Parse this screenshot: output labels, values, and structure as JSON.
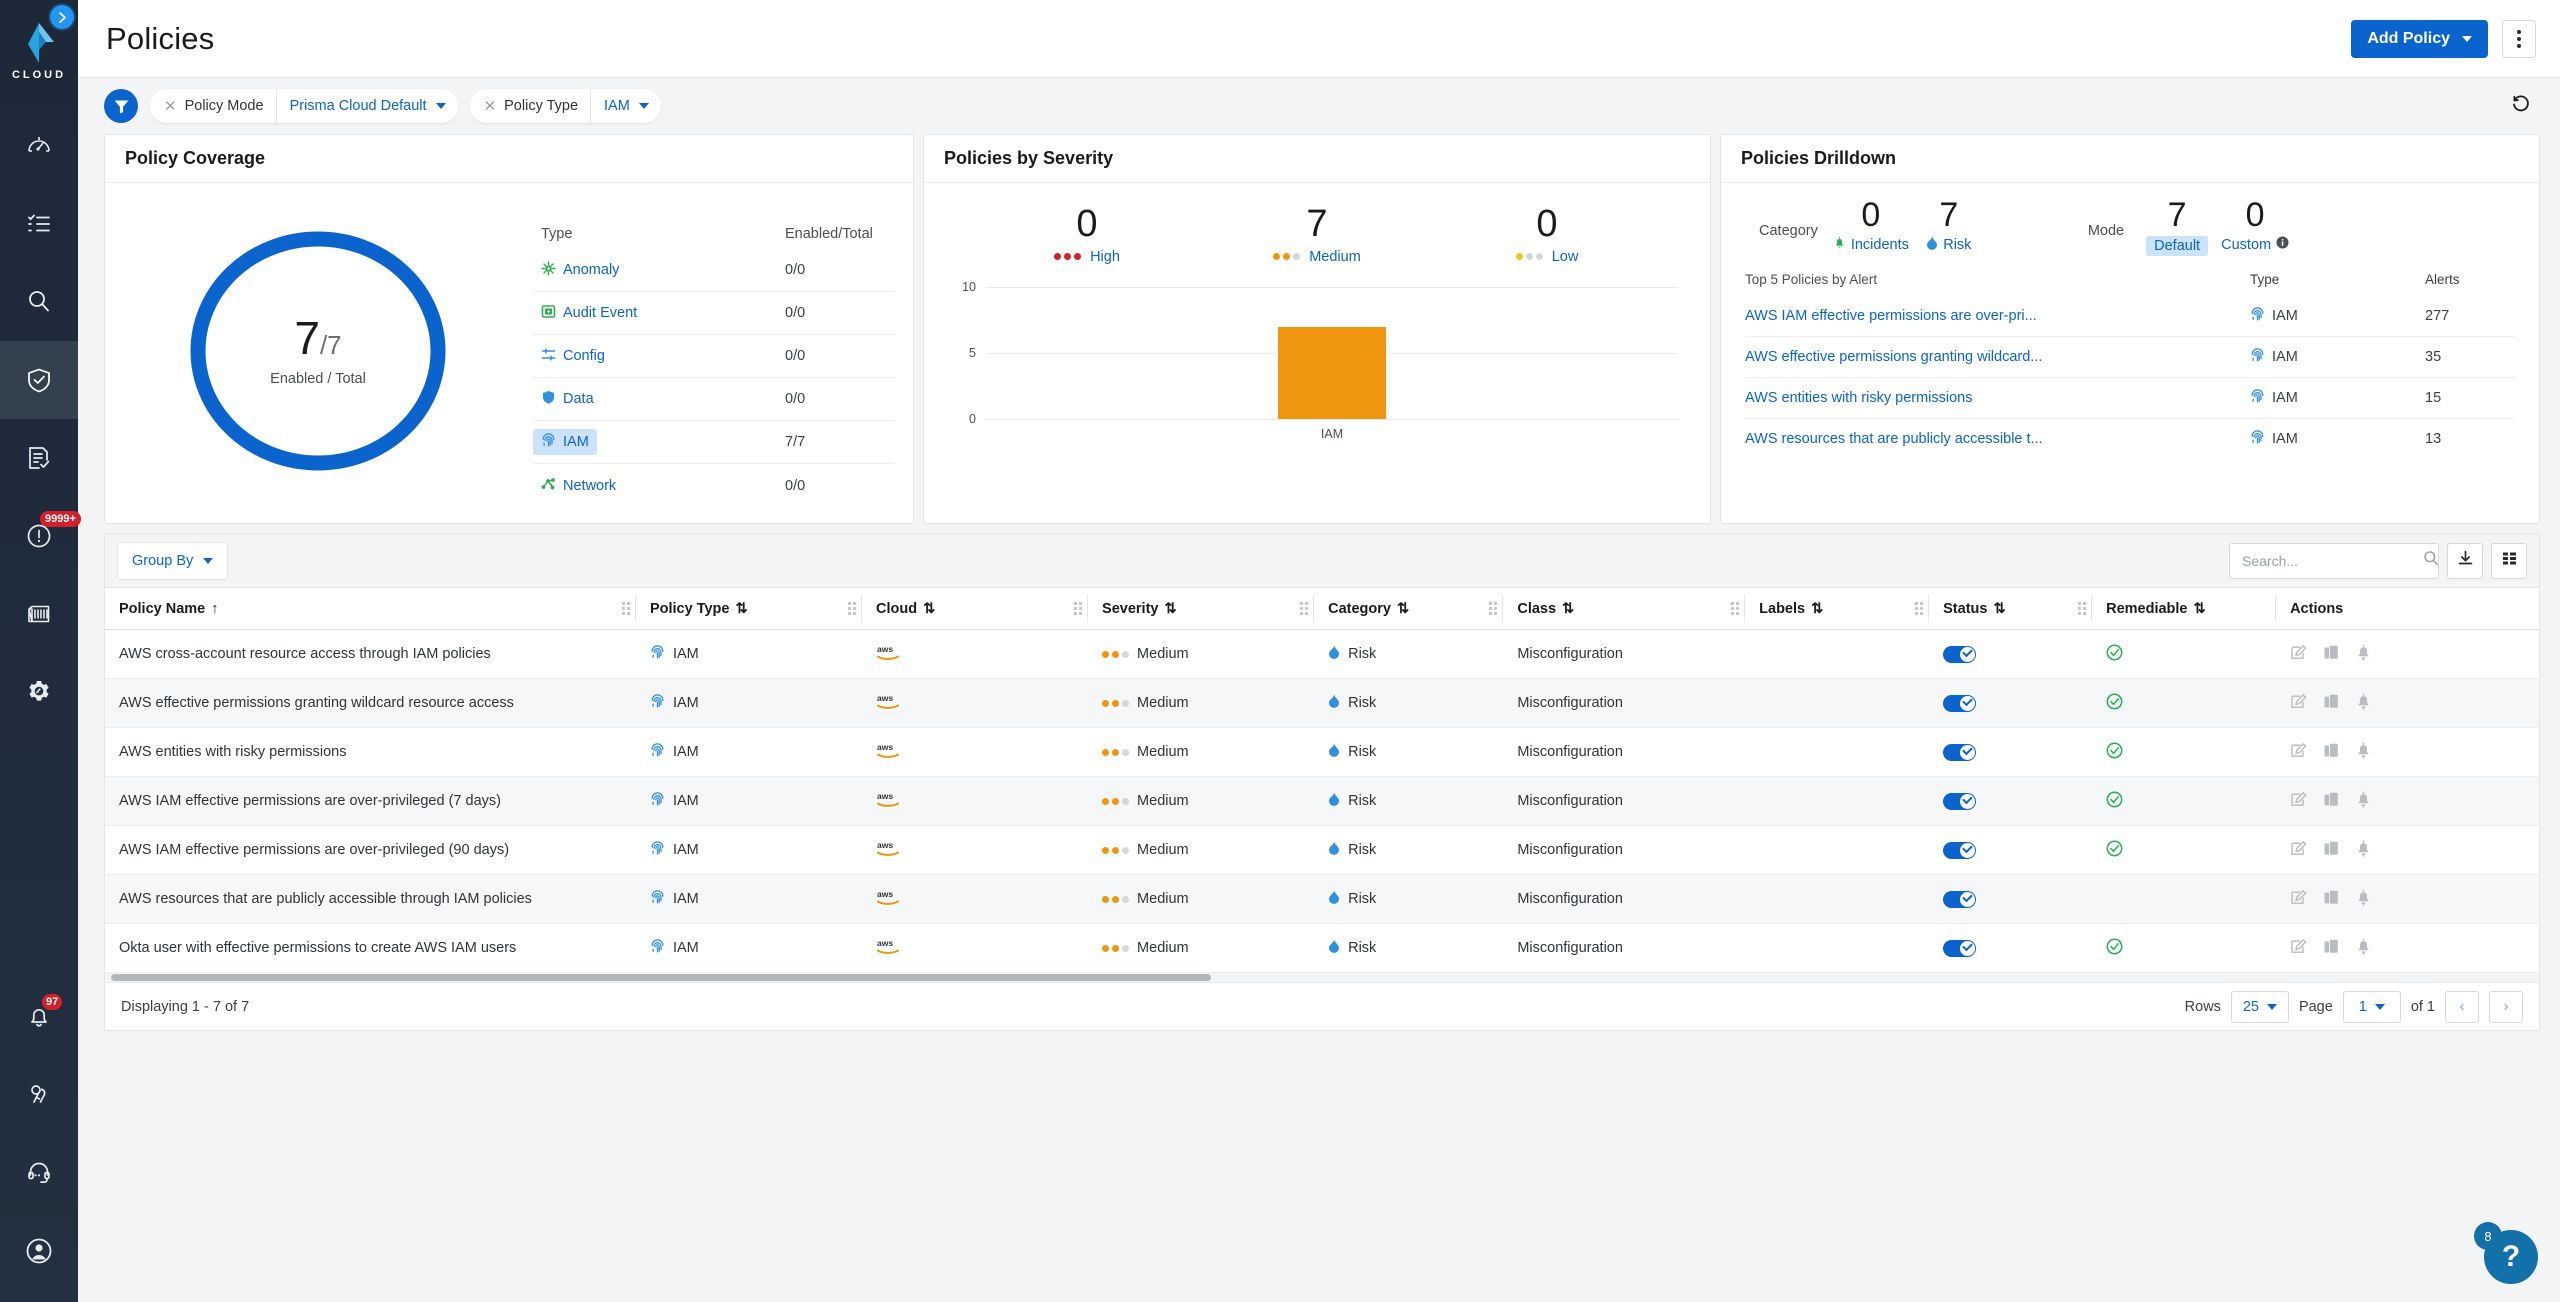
{
  "sidebar": {
    "logo_text": "CLOUD",
    "expand_icon": "chevron-right-icon",
    "items": [
      {
        "name": "dashboard",
        "icon": "speedometer-icon",
        "badge": null,
        "active": false
      },
      {
        "name": "inventory",
        "icon": "checklist-icon",
        "badge": null,
        "active": false
      },
      {
        "name": "investigate",
        "icon": "magnifier-icon",
        "badge": null,
        "active": false
      },
      {
        "name": "policies",
        "icon": "shield-check-icon",
        "badge": null,
        "active": true
      },
      {
        "name": "compliance",
        "icon": "document-check-icon",
        "badge": null,
        "active": false
      },
      {
        "name": "alerts",
        "icon": "alert-circle-icon",
        "badge": "9999+",
        "active": false
      },
      {
        "name": "containers",
        "icon": "container-icon",
        "badge": null,
        "active": false
      },
      {
        "name": "settings",
        "icon": "gear-icon",
        "badge": null,
        "active": false
      }
    ],
    "bottom_items": [
      {
        "name": "notifications",
        "icon": "bell-icon",
        "badge": "97"
      },
      {
        "name": "access-keys",
        "icon": "keys-icon",
        "badge": null
      },
      {
        "name": "support",
        "icon": "headset-icon",
        "badge": null
      },
      {
        "name": "profile",
        "icon": "user-avatar-icon",
        "badge": null
      }
    ]
  },
  "header": {
    "title": "Policies",
    "add_policy_label": "Add Policy",
    "kebab_icon": "more-vertical-icon"
  },
  "filterbar": {
    "filter_icon": "funnel-icon",
    "reset_icon": "reset-icon",
    "chips": [
      {
        "label": "Policy Mode",
        "value": "Prisma Cloud Default"
      },
      {
        "label": "Policy Type",
        "value": "IAM"
      }
    ]
  },
  "coverage": {
    "title": "Policy Coverage",
    "donut_value": "7",
    "donut_total": "/7",
    "donut_caption": "Enabled / Total",
    "donut_color": "#0b63ce",
    "col_type": "Type",
    "col_enabled_total": "Enabled/Total",
    "rows": [
      {
        "type": "Anomaly",
        "icon": "anomaly-icon",
        "value": "0/0",
        "selected": false
      },
      {
        "type": "Audit Event",
        "icon": "audit-event-icon",
        "value": "0/0",
        "selected": false
      },
      {
        "type": "Config",
        "icon": "config-icon",
        "value": "0/0",
        "selected": false
      },
      {
        "type": "Data",
        "icon": "data-shield-icon",
        "value": "0/0",
        "selected": false
      },
      {
        "type": "IAM",
        "icon": "iam-fingerprint-icon",
        "value": "7/7",
        "selected": true
      },
      {
        "type": "Network",
        "icon": "network-icon",
        "value": "0/0",
        "selected": false
      }
    ]
  },
  "severity": {
    "title": "Policies by Severity",
    "stats": [
      {
        "count": "0",
        "label": "High",
        "color": "#d4202a",
        "filled": 3
      },
      {
        "count": "7",
        "label": "Medium",
        "color": "#ef9510",
        "filled": 2
      },
      {
        "count": "0",
        "label": "Low",
        "color": "#f5c518",
        "filled": 1
      }
    ]
  },
  "chart_data": {
    "type": "bar",
    "title": "Policies by Severity",
    "categories": [
      "IAM"
    ],
    "values": [
      7
    ],
    "series": [
      {
        "name": "Medium",
        "values": [
          7
        ],
        "color": "#ef9510"
      }
    ],
    "xlabel": "",
    "ylabel": "",
    "ylim": [
      0,
      10
    ],
    "yticks": [
      0,
      5,
      10
    ],
    "grid": true,
    "legend": "none"
  },
  "drilldown": {
    "title": "Policies Drilldown",
    "category_label": "Category",
    "mode_label": "Mode",
    "category_stats": [
      {
        "count": "0",
        "label": "Incidents",
        "icon": "incident-bell-icon",
        "highlighted": false
      },
      {
        "count": "7",
        "label": "Risk",
        "icon": "risk-flame-icon",
        "highlighted": false
      }
    ],
    "mode_stats": [
      {
        "count": "7",
        "label": "Default",
        "icon": null,
        "highlighted": true
      },
      {
        "count": "0",
        "label": "Custom",
        "icon": "info-icon",
        "highlighted": false
      }
    ],
    "table_headers": [
      "Top 5 Policies by Alert",
      "Type",
      "Alerts"
    ],
    "rows": [
      {
        "policy": "AWS IAM effective permissions are over-pri...",
        "type": "IAM",
        "alerts": "277"
      },
      {
        "policy": "AWS effective permissions granting wildcard...",
        "type": "IAM",
        "alerts": "35"
      },
      {
        "policy": "AWS entities with risky permissions",
        "type": "IAM",
        "alerts": "15"
      },
      {
        "policy": "AWS resources that are publicly accessible t...",
        "type": "IAM",
        "alerts": "13"
      }
    ]
  },
  "table": {
    "group_by_label": "Group By",
    "search_placeholder": "Search...",
    "search_value": "",
    "download_icon": "download-icon",
    "columns_icon": "columns-settings-icon",
    "headers": [
      {
        "label": "Policy Name",
        "sort": "asc"
      },
      {
        "label": "Policy Type",
        "sort": "none"
      },
      {
        "label": "Cloud",
        "sort": "none"
      },
      {
        "label": "Severity",
        "sort": "none"
      },
      {
        "label": "Category",
        "sort": "none"
      },
      {
        "label": "Class",
        "sort": "none"
      },
      {
        "label": "Labels",
        "sort": "none"
      },
      {
        "label": "Status",
        "sort": "none"
      },
      {
        "label": "Remediable",
        "sort": "none"
      },
      {
        "label": "Actions",
        "sort": null
      }
    ],
    "rows": [
      {
        "name": "AWS cross-account resource access through IAM policies",
        "policy_type": "IAM",
        "cloud": "aws",
        "severity": "Medium",
        "category": "Risk",
        "class": "Misconfiguration",
        "labels": "",
        "status": true,
        "remediable": true
      },
      {
        "name": "AWS effective permissions granting wildcard resource access",
        "policy_type": "IAM",
        "cloud": "aws",
        "severity": "Medium",
        "category": "Risk",
        "class": "Misconfiguration",
        "labels": "",
        "status": true,
        "remediable": true
      },
      {
        "name": "AWS entities with risky permissions",
        "policy_type": "IAM",
        "cloud": "aws",
        "severity": "Medium",
        "category": "Risk",
        "class": "Misconfiguration",
        "labels": "",
        "status": true,
        "remediable": true
      },
      {
        "name": "AWS IAM effective permissions are over-privileged (7 days)",
        "policy_type": "IAM",
        "cloud": "aws",
        "severity": "Medium",
        "category": "Risk",
        "class": "Misconfiguration",
        "labels": "",
        "status": true,
        "remediable": true
      },
      {
        "name": "AWS IAM effective permissions are over-privileged (90 days)",
        "policy_type": "IAM",
        "cloud": "aws",
        "severity": "Medium",
        "category": "Risk",
        "class": "Misconfiguration",
        "labels": "",
        "status": true,
        "remediable": true
      },
      {
        "name": "AWS resources that are publicly accessible through IAM policies",
        "policy_type": "IAM",
        "cloud": "aws",
        "severity": "Medium",
        "category": "Risk",
        "class": "Misconfiguration",
        "labels": "",
        "status": true,
        "remediable": false
      },
      {
        "name": "Okta user with effective permissions to create AWS IAM users",
        "policy_type": "IAM",
        "cloud": "aws",
        "severity": "Medium",
        "category": "Risk",
        "class": "Misconfiguration",
        "labels": "",
        "status": true,
        "remediable": true
      }
    ],
    "row_actions": [
      "edit-icon",
      "clone-icon",
      "bell-icon"
    ],
    "footer": {
      "displaying": "Displaying 1 - 7 of 7",
      "rows_label": "Rows",
      "rows_value": "25",
      "page_label": "Page",
      "page_value": "1",
      "of_label": "of 1",
      "prev_icon": "chevron-left-icon",
      "next_icon": "chevron-right-icon"
    }
  },
  "help": {
    "icon": "question-mark-icon",
    "badge": "8"
  }
}
